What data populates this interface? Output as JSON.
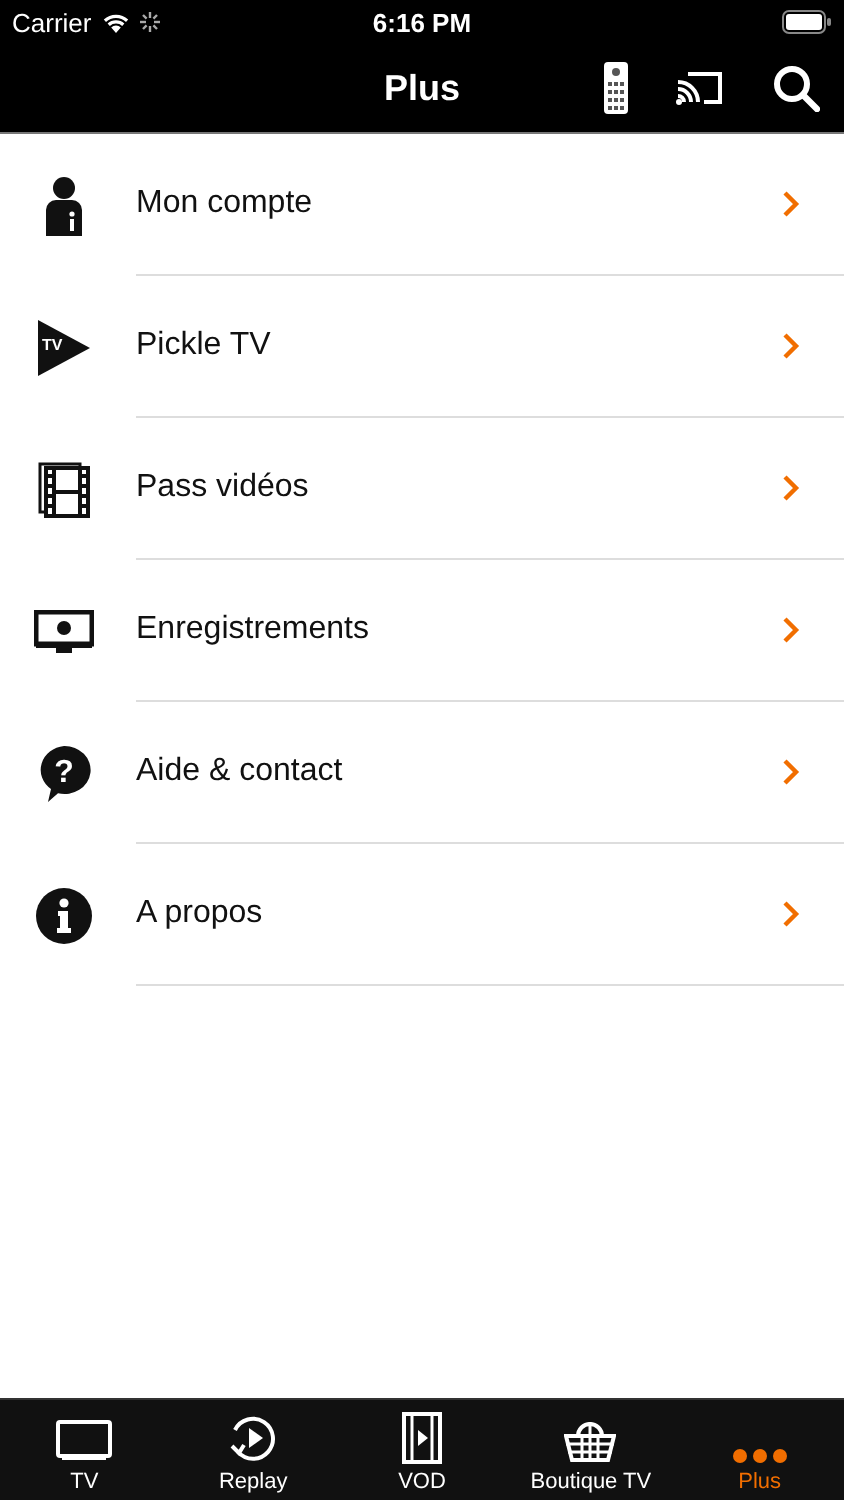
{
  "status_bar": {
    "carrier": "Carrier",
    "time": "6:16 PM"
  },
  "nav_bar": {
    "title": "Plus"
  },
  "menu_items": [
    {
      "kind": "account",
      "label": "Mon compte"
    },
    {
      "kind": "tv_play",
      "label": "Pickle TV",
      "icon_text": "TV"
    },
    {
      "kind": "film",
      "label": "Pass vidéos"
    },
    {
      "kind": "recording",
      "label": "Enregistrements"
    },
    {
      "kind": "help",
      "label": "Aide & contact",
      "icon_text": "?"
    },
    {
      "kind": "info",
      "label": "A propos"
    }
  ],
  "tab_bar": [
    {
      "kind": "tv",
      "label": "TV",
      "selected": false
    },
    {
      "kind": "replay",
      "label": "Replay",
      "selected": false
    },
    {
      "kind": "vod",
      "label": "VOD",
      "selected": false
    },
    {
      "kind": "basket",
      "label": "Boutique TV",
      "selected": false
    },
    {
      "kind": "more",
      "label": "Plus",
      "selected": true
    }
  ]
}
